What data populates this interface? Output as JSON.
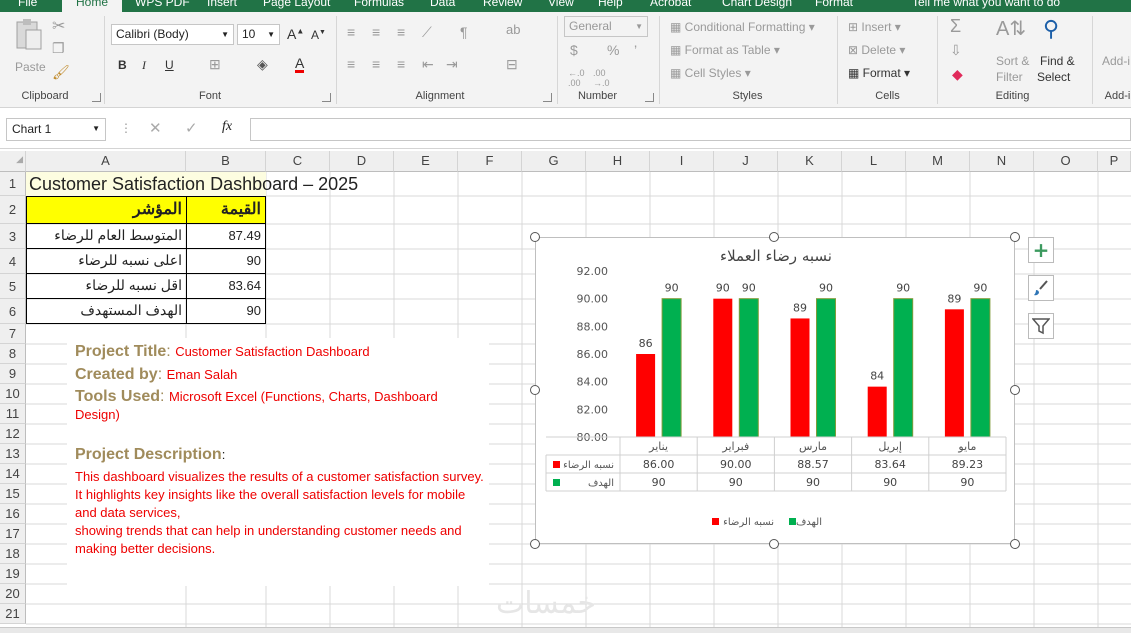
{
  "ribbon_tabs": [
    "File",
    "Home",
    "WPS PDF",
    "Insert",
    "Page Layout",
    "Formulas",
    "Data",
    "Review",
    "View",
    "Help",
    "Acrobat",
    "Chart Design",
    "Format",
    "Tell me what you want to do"
  ],
  "ribbon": {
    "clipboard": {
      "paste": "Paste",
      "label": "Clipboard"
    },
    "font": {
      "name": "Calibri (Body)",
      "size": "10",
      "label": "Font",
      "bold": "B",
      "italic": "I",
      "underline": "U"
    },
    "alignment": {
      "label": "Alignment"
    },
    "number": {
      "format": "General",
      "currency": "$",
      "percent": "%",
      "comma": "’",
      "label": "Number"
    },
    "styles": {
      "conditional": "Conditional Formatting",
      "format_table": "Format as Table",
      "cell_styles": "Cell Styles",
      "label": "Styles"
    },
    "cells": {
      "insert": "Insert",
      "delete": "Delete",
      "format": "Format",
      "label": "Cells"
    },
    "editing": {
      "sort_filter_1": "Sort &",
      "sort_filter_2": "Filter",
      "find_select_1": "Find &",
      "find_select_2": "Select",
      "label": "Editing"
    },
    "addins": {
      "button": "Add-i",
      "label": "Add-i"
    }
  },
  "formula_bar": {
    "name_box": "Chart 1",
    "fx": "fx",
    "value": ""
  },
  "columns": [
    "A",
    "B",
    "C",
    "D",
    "E",
    "F",
    "G",
    "H",
    "I",
    "J",
    "K",
    "L",
    "M",
    "N",
    "O",
    "P"
  ],
  "rows": [
    "1",
    "2",
    "3",
    "4",
    "5",
    "6",
    "7",
    "8",
    "9",
    "10",
    "11",
    "12",
    "13",
    "14",
    "15",
    "16",
    "17",
    "18",
    "19",
    "20",
    "21"
  ],
  "sheet": {
    "title": "Customer Satisfaction Dashboard – 2025",
    "header_indicator": "المؤشر",
    "header_value": "القيمة",
    "kpis": [
      {
        "label": "المتوسط العام للرضاء",
        "value": "87.49"
      },
      {
        "label": "اعلى نسبه للرضاء",
        "value": "90"
      },
      {
        "label": "اقل نسبه للرضاء",
        "value": "83.64"
      },
      {
        "label": "الهدف المستهدف",
        "value": "90"
      }
    ]
  },
  "info": {
    "title_key": "Project Title",
    "title_val": "Customer Satisfaction Dashboard",
    "created_key": "Created by",
    "created_val": "Eman Salah",
    "tools_key": "Tools Used",
    "tools_val": "Microsoft Excel (Functions, Charts, Dashboard Design)",
    "desc_key": "Project Description",
    "desc_lines": [
      "This dashboard visualizes the results of a customer satisfaction survey.",
      "It highlights key insights like the overall satisfaction levels for mobile and data services,",
      "showing trends that can help in understanding customer needs and making better decisions."
    ]
  },
  "watermark": "خمسات",
  "colors": {
    "ribbon": "#217346",
    "header_fill": "#ffff00",
    "series1": "#ff0000",
    "series2": "#00b050",
    "info_key": "#a08b5b",
    "info_value": "#e00000"
  },
  "chart_data": {
    "type": "bar",
    "title": "نسبه رضاء العملاء",
    "categories": [
      "يناير",
      "فبراير",
      "مارس",
      "إبريل",
      "مايو"
    ],
    "series": [
      {
        "name": "نسبه الرضاء",
        "values": [
          86.0,
          90.0,
          88.57,
          83.64,
          89.23
        ],
        "data_labels": [
          "86",
          "90",
          "89",
          "84",
          "89"
        ],
        "table_values": [
          "86.00",
          "90.00",
          "88.57",
          "83.64",
          "89.23"
        ],
        "color": "#ff0000"
      },
      {
        "name": "الهدف",
        "values": [
          90,
          90,
          90,
          90,
          90
        ],
        "data_labels": [
          "90",
          "90",
          "90",
          "90",
          "90"
        ],
        "table_values": [
          "90",
          "90",
          "90",
          "90",
          "90"
        ],
        "color": "#00b050"
      }
    ],
    "ylim": [
      80,
      92
    ],
    "yticks": [
      "80.00",
      "82.00",
      "84.00",
      "86.00",
      "88.00",
      "90.00",
      "92.00"
    ],
    "grid": false,
    "data_table": true,
    "legend": "bottom"
  }
}
